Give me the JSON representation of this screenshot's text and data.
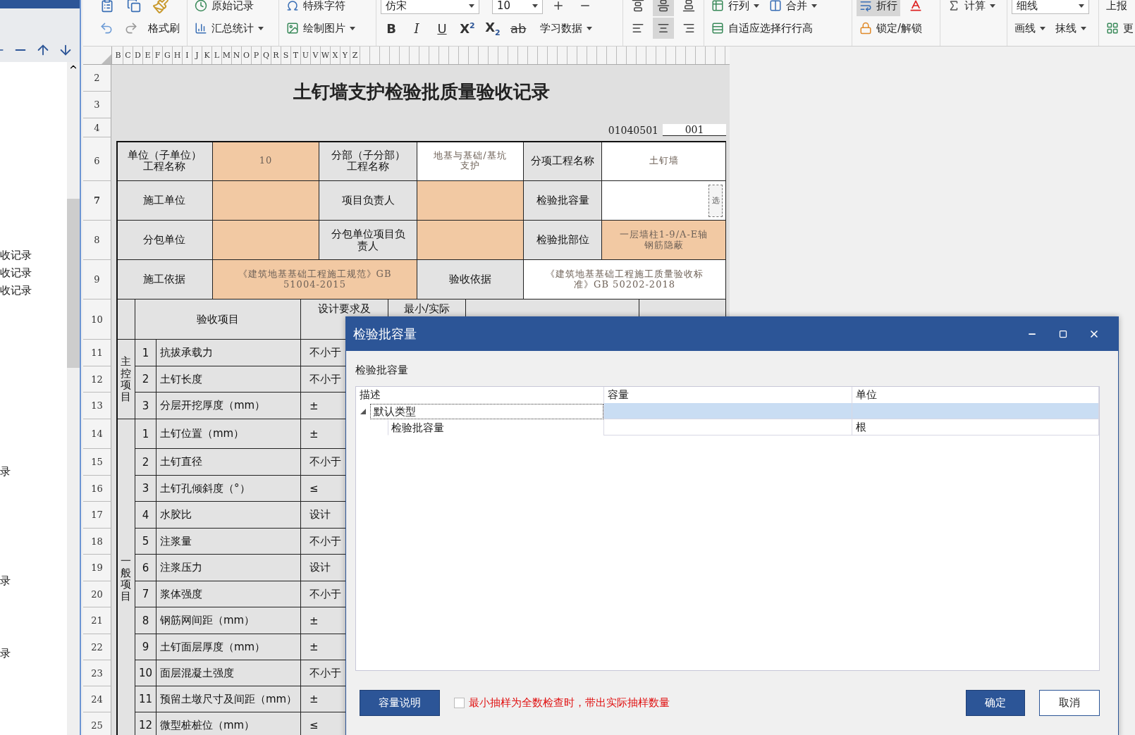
{
  "left_panel": {
    "items": [
      {
        "text": "收记录"
      },
      {
        "text": "收记录"
      },
      {
        "text": "收记录"
      },
      {
        "text": "录"
      },
      {
        "text": "录"
      },
      {
        "text": "录"
      }
    ]
  },
  "toolbar": {
    "format_painter": "格式刷",
    "original_record": "原始记录",
    "summary": "汇总统计",
    "special_chars": "特殊字符",
    "draw_picture": "绘制图片",
    "font": "仿宋",
    "font_size": "10",
    "bold": "B",
    "italic": "I",
    "underline": "U",
    "superscript": "X$^{2}$",
    "subscript": "X$_{2}$",
    "strikethrough": "ab",
    "learn_data": "学习数据",
    "valign": [
      {
        "selected": false
      },
      {
        "selected": true
      },
      {
        "selected": false
      }
    ],
    "halign": [
      {
        "selected": false
      },
      {
        "selected": true
      },
      {
        "selected": false
      }
    ],
    "rows_cols": "行列",
    "merge": "合并",
    "autofit": "自适应选择行行高",
    "wrap": {
      "label": "折行",
      "selected": true
    },
    "calc": "计算",
    "lock": "锁定/解锁",
    "line_style": "细线",
    "draw_line": "画线",
    "erase_line": "抹线",
    "report": "上报",
    "more": "更"
  },
  "column_headers": [
    "B",
    "C",
    "D",
    "E",
    "F",
    "G",
    "H",
    "I",
    "J",
    "K",
    "L",
    "M",
    "N",
    "O",
    "P",
    "Q",
    "R",
    "S",
    "T",
    "U",
    "V",
    "W",
    "X",
    "Y",
    "Z"
  ],
  "row_headers": [
    {
      "label": "2",
      "selected": false
    },
    {
      "label": "3",
      "selected": false
    },
    {
      "label": "4",
      "selected": false
    },
    {
      "label": "6",
      "selected": false
    },
    {
      "label": "7",
      "selected": true
    },
    {
      "label": "8",
      "selected": false
    },
    {
      "label": "9",
      "selected": false
    },
    {
      "label": "10",
      "selected": false
    },
    {
      "label": "11",
      "selected": false
    },
    {
      "label": "12",
      "selected": false
    },
    {
      "label": "13",
      "selected": false
    },
    {
      "label": "14",
      "selected": false
    },
    {
      "label": "15",
      "selected": false
    },
    {
      "label": "16",
      "selected": false
    },
    {
      "label": "17",
      "selected": false
    },
    {
      "label": "18",
      "selected": false
    },
    {
      "label": "19",
      "selected": false
    },
    {
      "label": "20",
      "selected": false
    },
    {
      "label": "21",
      "selected": false
    },
    {
      "label": "22",
      "selected": false
    },
    {
      "label": "23",
      "selected": false
    },
    {
      "label": "24",
      "selected": false
    },
    {
      "label": "25",
      "selected": false
    }
  ],
  "form": {
    "title": "土钉墙支护检验批质量验收记录",
    "code": "01040501",
    "number": "001",
    "header_rows": [
      [
        {
          "kind": "label",
          "text": "单位（子单位）工程名称"
        },
        {
          "kind": "input",
          "text": "10"
        },
        {
          "kind": "label",
          "text": "分部（子分部）工程名称"
        },
        {
          "kind": "fixed",
          "text": "地基与基础/基坑支护"
        },
        {
          "kind": "label",
          "text": "分项工程名称"
        },
        {
          "kind": "fixed",
          "text": "土钉墙"
        }
      ],
      [
        {
          "kind": "label",
          "text": "施工单位"
        },
        {
          "kind": "input"
        },
        {
          "kind": "label",
          "text": "项目负责人"
        },
        {
          "kind": "input"
        },
        {
          "kind": "label",
          "text": "检验批容量"
        },
        {
          "kind": "picker",
          "text": "选"
        }
      ],
      [
        {
          "kind": "label",
          "text": "分包单位"
        },
        {
          "kind": "input"
        },
        {
          "kind": "label",
          "text": "分包单位项目负责人"
        },
        {
          "kind": "input"
        },
        {
          "kind": "label",
          "text": "检验批部位"
        },
        {
          "kind": "input",
          "text": "一层墙柱1-9/A-E轴钢筋隐蔽"
        }
      ],
      [
        {
          "kind": "label",
          "text": "施工依据"
        },
        {
          "kind": "input",
          "text": "《建筑地基基础工程施工规范》GB 51004-2015"
        },
        {
          "kind": "label",
          "text": "验收依据"
        },
        {
          "kind": "fixed",
          "text": "《建筑地基基础工程施工质量验收标准》GB 50202-2018"
        }
      ]
    ],
    "items_header": {
      "item": "验收项目",
      "design": "设计要求及",
      "min": "最小/实际"
    },
    "groups": [
      {
        "label": "主控项目",
        "items": [
          {
            "no": "1",
            "name": "抗拔承载力",
            "design": "不小于"
          },
          {
            "no": "2",
            "name": "土钉长度",
            "design": "不小于"
          },
          {
            "no": "3",
            "name": "分层开挖厚度（mm）",
            "design": "±"
          }
        ]
      },
      {
        "label": "一般项目",
        "items": [
          {
            "no": "1",
            "name": "土钉位置（mm）",
            "design": "±"
          },
          {
            "no": "2",
            "name": "土钉直径",
            "design": "不小于"
          },
          {
            "no": "3",
            "name": "土钉孔倾斜度（°）",
            "design": "≤"
          },
          {
            "no": "4",
            "name": "水胶比",
            "design": "设计"
          },
          {
            "no": "5",
            "name": "注浆量",
            "design": "不小于"
          },
          {
            "no": "6",
            "name": "注浆压力",
            "design": "设计"
          },
          {
            "no": "7",
            "name": "浆体强度",
            "design": "不小于"
          },
          {
            "no": "8",
            "name": "钢筋网间距（mm）",
            "design": "±"
          },
          {
            "no": "9",
            "name": "土钉面层厚度（mm）",
            "design": "±"
          },
          {
            "no": "10",
            "name": "面层混凝土强度",
            "design": "不小于"
          },
          {
            "no": "11",
            "name": "预留土墩尺寸及间距（mm）",
            "design": "±"
          },
          {
            "no": "12",
            "name": "微型桩桩位（mm）",
            "design": "≤"
          }
        ]
      }
    ]
  },
  "dialog": {
    "title": "检验批容量",
    "label": "检验批容量",
    "columns": [
      "描述",
      "容量",
      "单位"
    ],
    "rows": [
      {
        "name": "默认类型",
        "expanded": true,
        "selected": true,
        "children": [
          {
            "name": "检验批容量",
            "unit": "根",
            "selected": false
          }
        ]
      }
    ],
    "info_button": "容量说明",
    "checkbox": {
      "label": "最小抽样为全数检查时，带出实际抽样数量",
      "checked": false
    },
    "ok": "确定",
    "cancel": "取消"
  }
}
